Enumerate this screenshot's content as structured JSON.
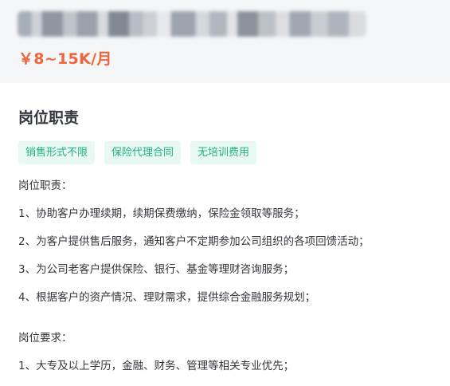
{
  "job": {
    "salary": "￥8~15K/月"
  },
  "section": {
    "title": "岗位职责"
  },
  "tags": [
    "销售形式不限",
    "保险代理合同",
    "无培训费用"
  ],
  "description": {
    "duties_heading": "岗位职责：",
    "duties": [
      "1、协助客户办理续期，续期保费缴纳，保险金领取等服务；",
      "2、为客户提供售后服务，通知客户不定期参加公司组织的各项回馈活动；",
      "3、为公司老客户提供保险、银行、基金等理财咨询服务；",
      "4、根据客户的资产情况、理财需求，提供综合金融服务规划；"
    ],
    "requirements_heading": "岗位要求：",
    "requirements": [
      "1、大专及以上学历，金融、财务、管理等相关专业优先；"
    ]
  },
  "colors": {
    "salary": "#f0643c",
    "tag_bg": "#e8f8f2",
    "tag_text": "#23b083",
    "header_bg": "#f5f6f8"
  }
}
